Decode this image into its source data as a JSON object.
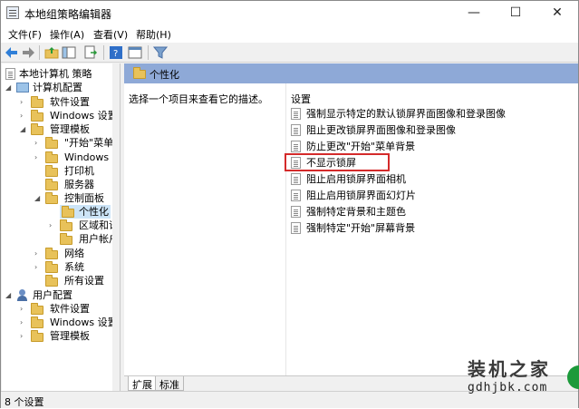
{
  "window": {
    "title": "本地组策略编辑器",
    "minimize": "—",
    "maximize": "☐",
    "close": "✕"
  },
  "menu": [
    "文件(F)",
    "操作(A)",
    "查看(V)",
    "帮助(H)"
  ],
  "tree": {
    "root": "本地计算机 策略",
    "computer_config": "计算机配置",
    "software_settings": "软件设置",
    "windows_settings": "Windows 设置",
    "admin_templates": "管理模板",
    "start_menu": "\"开始\"菜单和",
    "windows_components": "Windows 组件",
    "printers": "打印机",
    "server": "服务器",
    "control_panel": "控制面板",
    "personalization": "个性化",
    "region_language": "区域和语言",
    "user_accounts": "用户帐户",
    "network": "网络",
    "system": "系统",
    "all_settings": "所有设置",
    "user_config": "用户配置",
    "user_software": "软件设置",
    "user_windows": "Windows 设置",
    "user_admin": "管理模板"
  },
  "right": {
    "header": "个性化",
    "description": "选择一个项目来查看它的描述。",
    "column_header": "设置",
    "policies": [
      "强制显示特定的默认锁屏界面图像和登录图像",
      "阻止更改锁屏界面图像和登录图像",
      "防止更改\"开始\"菜单背景",
      "不显示锁屏",
      "阻止启用锁屏界面相机",
      "阻止启用锁屏界面幻灯片",
      "强制特定背景和主题色",
      "强制特定\"开始\"屏幕背景"
    ]
  },
  "tabs": [
    "扩展",
    "标准"
  ],
  "status": "8 个设置",
  "watermark": {
    "title": "装机之家",
    "url": "gdhjbk.com"
  },
  "colors": {
    "header": "#8ea9d7",
    "highlight_box": "#d42a2a",
    "selection": "#cce4f7"
  }
}
